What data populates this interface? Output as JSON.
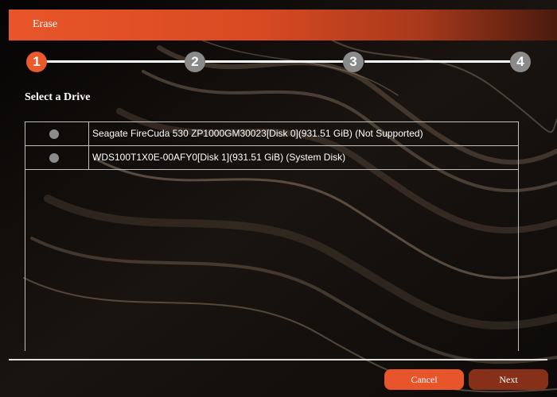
{
  "window": {
    "title": "Erase"
  },
  "steps": [
    "1",
    "2",
    "3",
    "4"
  ],
  "active_step": 1,
  "section_title": "Select a Drive",
  "drives": [
    {
      "label": "Seagate FireCuda 530 ZP1000GM30023[Disk 0](931.51 GiB) (Not Supported)",
      "selected": false
    },
    {
      "label": "WDS100T1X0E-00AFY0[Disk 1](931.51 GiB) (System Disk)",
      "selected": false
    }
  ],
  "buttons": {
    "cancel": "Cancel",
    "next": "Next"
  },
  "colors": {
    "accent": "#e8552a",
    "next_button": "#86301a",
    "step_inactive": "#8a8a8a"
  }
}
